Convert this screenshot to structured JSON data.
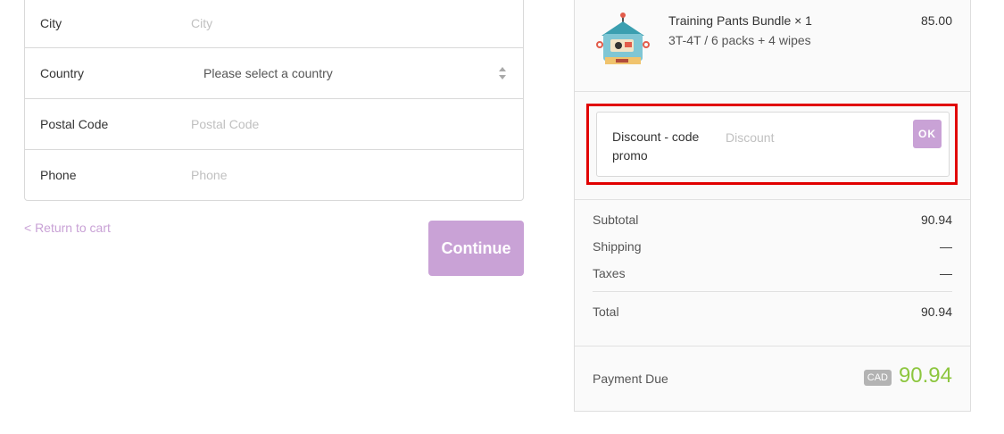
{
  "form": {
    "rows": [
      {
        "label": "City",
        "placeholder": "City"
      },
      {
        "label": "Country",
        "value": "Please select a country"
      },
      {
        "label": "Postal Code",
        "placeholder": "Postal Code"
      },
      {
        "label": "Phone",
        "placeholder": "Phone"
      }
    ]
  },
  "nav": {
    "return_label": "< Return to cart",
    "continue_label": "Continue"
  },
  "summary": {
    "product": {
      "name": "Training Pants Bundle × 1",
      "variant": "3T-4T / 6 packs + 4 wipes",
      "price": "85.00",
      "image_icon": "robot-product-image"
    },
    "discount": {
      "label": "Discount - code promo",
      "placeholder": "Discount",
      "button_label": "OK"
    },
    "totals": {
      "subtotal_label": "Subtotal",
      "subtotal_value": "90.94",
      "shipping_label": "Shipping",
      "shipping_value": "—",
      "taxes_label": "Taxes",
      "taxes_value": "—",
      "total_label": "Total",
      "total_value": "90.94"
    },
    "payment": {
      "label": "Payment Due",
      "currency": "CAD",
      "amount": "90.94"
    }
  },
  "colors": {
    "accent": "#c9a2d6",
    "amount_green": "#8dc63f",
    "highlight_red": "#e10000"
  }
}
